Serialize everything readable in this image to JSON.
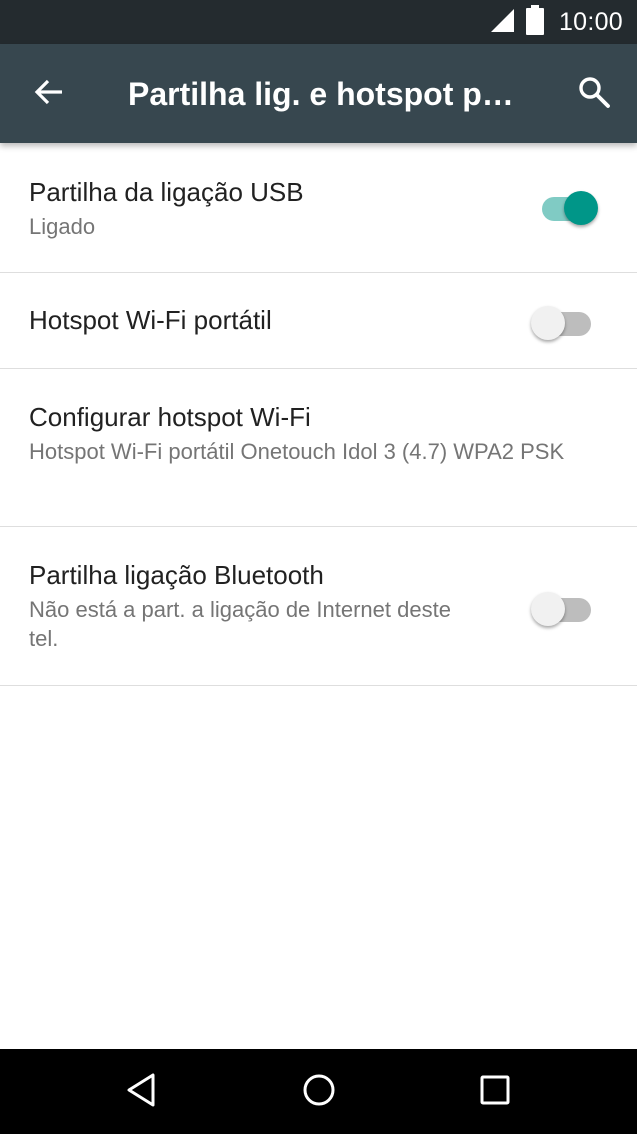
{
  "status_bar": {
    "time": "10:00",
    "icons": [
      "signal-icon",
      "battery-icon"
    ]
  },
  "app_bar": {
    "title": "Partilha lig. e hotspot portátil",
    "back_icon": "arrow-back-icon",
    "search_icon": "search-icon",
    "background_color": "#37474f"
  },
  "settings": {
    "usb": {
      "title": "Partilha da ligação USB",
      "summary": "Ligado",
      "enabled": true
    },
    "wifi_hotspot": {
      "title": "Hotspot Wi-Fi portátil",
      "enabled": false
    },
    "configure_hotspot": {
      "title": "Configurar hotspot Wi-Fi",
      "summary": "Hotspot Wi-Fi portátil Onetouch Idol 3 (4.7) WPA2 PSK"
    },
    "bluetooth": {
      "title": "Partilha ligação Bluetooth",
      "summary": "Não está a part. a ligação de Internet deste tel.",
      "enabled": false
    }
  },
  "colors": {
    "accent": "#009688",
    "accent_track": "#80cbc4"
  },
  "nav_bar": {
    "icons": [
      "back-triangle-icon",
      "home-circle-icon",
      "recents-square-icon"
    ]
  }
}
